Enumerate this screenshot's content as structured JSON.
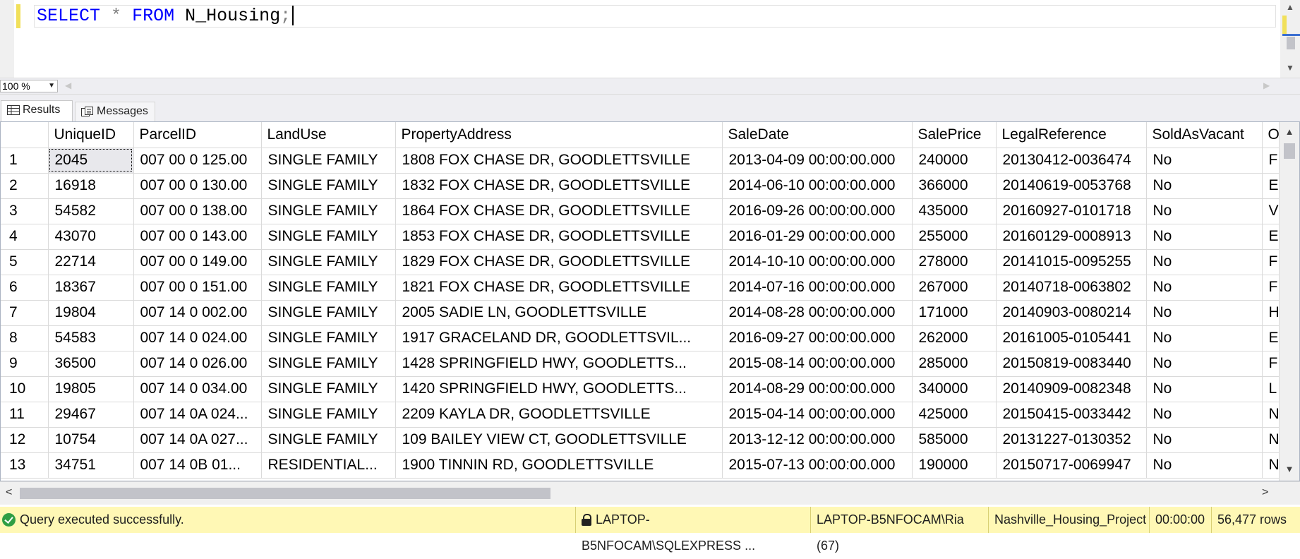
{
  "editor": {
    "tokens": {
      "kw1": "SELECT",
      "op": "*",
      "kw2": "FROM",
      "table": "N_Housing",
      "semi": ";"
    }
  },
  "zoom": {
    "value": "100 %"
  },
  "tabs": {
    "results": "Results",
    "messages": "Messages"
  },
  "grid": {
    "columns": [
      "UniqueID",
      "ParcelID",
      "LandUse",
      "PropertyAddress",
      "SaleDate",
      "SalePrice",
      "LegalReference",
      "SoldAsVacant",
      "O"
    ],
    "rows": [
      [
        "1",
        "2045",
        "007 00 0 125.00",
        "SINGLE FAMILY",
        "1808  FOX CHASE DR, GOODLETTSVILLE",
        "2013-04-09 00:00:00.000",
        "240000",
        "20130412-0036474",
        "No",
        "F"
      ],
      [
        "2",
        "16918",
        "007 00 0 130.00",
        "SINGLE FAMILY",
        "1832  FOX CHASE DR, GOODLETTSVILLE",
        "2014-06-10 00:00:00.000",
        "366000",
        "20140619-0053768",
        "No",
        "E"
      ],
      [
        "3",
        "54582",
        "007 00 0 138.00",
        "SINGLE FAMILY",
        "1864 FOX CHASE  DR, GOODLETTSVILLE",
        "2016-09-26 00:00:00.000",
        "435000",
        "20160927-0101718",
        "No",
        "V"
      ],
      [
        "4",
        "43070",
        "007 00 0 143.00",
        "SINGLE FAMILY",
        "1853  FOX CHASE DR, GOODLETTSVILLE",
        "2016-01-29 00:00:00.000",
        "255000",
        "20160129-0008913",
        "No",
        "E"
      ],
      [
        "5",
        "22714",
        "007 00 0 149.00",
        "SINGLE FAMILY",
        "1829  FOX CHASE DR, GOODLETTSVILLE",
        "2014-10-10 00:00:00.000",
        "278000",
        "20141015-0095255",
        "No",
        "F"
      ],
      [
        "6",
        "18367",
        "007 00 0 151.00",
        "SINGLE FAMILY",
        "1821  FOX CHASE DR, GOODLETTSVILLE",
        "2014-07-16 00:00:00.000",
        "267000",
        "20140718-0063802",
        "No",
        "F"
      ],
      [
        "7",
        "19804",
        "007 14 0 002.00",
        "SINGLE FAMILY",
        "2005  SADIE LN, GOODLETTSVILLE",
        "2014-08-28 00:00:00.000",
        "171000",
        "20140903-0080214",
        "No",
        "H"
      ],
      [
        "8",
        "54583",
        "007 14 0 024.00",
        "SINGLE FAMILY",
        "1917 GRACELAND  DR, GOODLETTSVIL...",
        "2016-09-27 00:00:00.000",
        "262000",
        "20161005-0105441",
        "No",
        "E"
      ],
      [
        "9",
        "36500",
        "007 14 0 026.00",
        "SINGLE FAMILY",
        "1428  SPRINGFIELD HWY, GOODLETTS...",
        "2015-08-14 00:00:00.000",
        "285000",
        "20150819-0083440",
        "No",
        "F"
      ],
      [
        "10",
        "19805",
        "007 14 0 034.00",
        "SINGLE FAMILY",
        "1420  SPRINGFIELD HWY, GOODLETTS...",
        "2014-08-29 00:00:00.000",
        "340000",
        "20140909-0082348",
        "No",
        "L"
      ],
      [
        "11",
        "29467",
        "007 14 0A 024...",
        "SINGLE FAMILY",
        "2209  KAYLA DR, GOODLETTSVILLE",
        "2015-04-14 00:00:00.000",
        "425000",
        "20150415-0033442",
        "No",
        "N"
      ],
      [
        "12",
        "10754",
        "007 14 0A 027...",
        "SINGLE FAMILY",
        "109  BAILEY VIEW CT, GOODLETTSVILLE",
        "2013-12-12 00:00:00.000",
        "585000",
        "20131227-0130352",
        "No",
        "N"
      ],
      [
        "13",
        "34751",
        "007 14 0B 01...",
        "RESIDENTIAL...",
        "1900  TINNIN RD, GOODLETTSVILLE",
        "2015-07-13 00:00:00.000",
        "190000",
        "20150717-0069947",
        "No",
        "N"
      ]
    ]
  },
  "status": {
    "message": "Query executed successfully.",
    "server": "LAPTOP-B5NFOCAM\\SQLEXPRESS ...",
    "user": "LAPTOP-B5NFOCAM\\Ria (67)",
    "database": "Nashville_Housing_Project",
    "elapsed": "00:00:00",
    "rows": "56,477 rows"
  },
  "colors": {
    "keyword": "#0000ff",
    "operator": "#808080",
    "statusbar_bg": "#fff8b5",
    "success": "#2f9e44"
  },
  "icons": [
    "results-grid-icon",
    "messages-icon",
    "success-check-icon",
    "lock-icon",
    "scroll-up-icon",
    "scroll-down-icon",
    "scroll-left-icon",
    "scroll-right-icon",
    "dropdown-arrow-icon"
  ]
}
